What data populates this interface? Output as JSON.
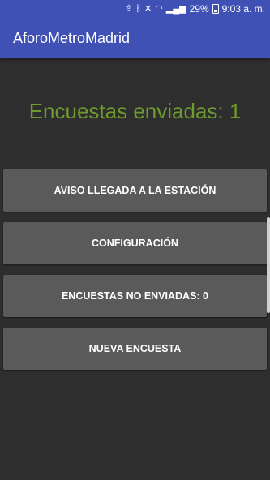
{
  "status_bar": {
    "icons": [
      "upload-icon",
      "bluetooth-icon",
      "mute-icon",
      "wifi-icon",
      "signal-icon"
    ],
    "battery": "29%",
    "time": "9:03 a. m."
  },
  "app_bar": {
    "title": "AforoMetroMadrid"
  },
  "main": {
    "counter_text": "Encuestas enviadas: 1",
    "buttons": [
      "AVISO LLEGADA A LA ESTACIÓN",
      "CONFIGURACIÓN",
      "ENCUESTAS NO ENVIADAS: 0",
      "NUEVA ENCUESTA"
    ]
  },
  "colors": {
    "primary": "#3f51b5",
    "background": "#2e2e2e",
    "counter_text": "#6e9a2e",
    "button": "#5a5a5a"
  }
}
